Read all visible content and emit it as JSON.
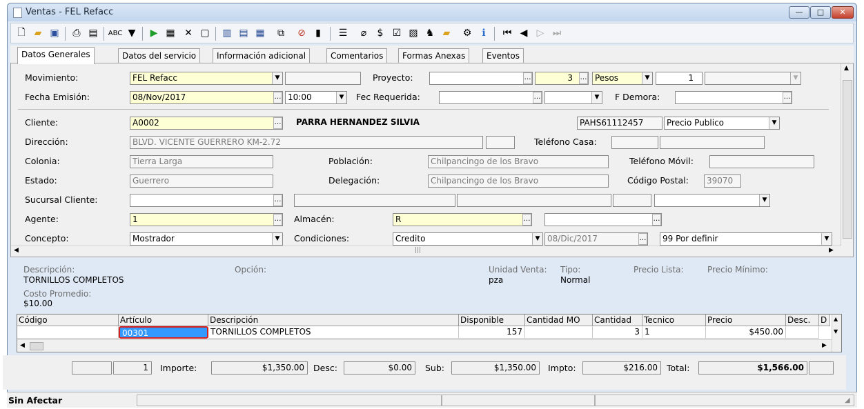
{
  "window": {
    "title": "Ventas - FEL Refacc"
  },
  "tabs": [
    "Datos Generales",
    "Datos del servicio",
    "Información adicional",
    "Comentarios",
    "Formas Anexas",
    "Eventos"
  ],
  "form": {
    "movimiento_label": "Movimiento:",
    "movimiento_value": "FEL Refacc",
    "proyecto_label": "Proyecto:",
    "proyecto_num": "3",
    "moneda": "Pesos",
    "tipo_cambio": "1",
    "fecha_emision_label": "Fecha Emisión:",
    "fecha_emision": "08/Nov/2017",
    "hora": "10:00",
    "fec_requerida_label": "Fec Requerida:",
    "f_demora_label": "F Demora:",
    "cliente_label": "Cliente:",
    "cliente_codigo": "A0002",
    "cliente_nombre": "PARRA HERNANDEZ SILVIA",
    "rfc": "PAHS61112457",
    "lista_precios": "Precio Publico",
    "direccion_label": "Dirección:",
    "direccion": "BLVD. VICENTE GUERRERO KM-2.72",
    "telefono_casa_label": "Teléfono Casa:",
    "colonia_label": "Colonia:",
    "colonia": "Tierra Larga",
    "poblacion_label": "Población:",
    "poblacion": "Chilpancingo de los Bravo",
    "telefono_movil_label": "Teléfono Móvil:",
    "estado_label": "Estado:",
    "estado": "Guerrero",
    "delegacion_label": "Delegación:",
    "delegacion": "Chilpancingo de los Bravo",
    "codigo_postal_label": "Código Postal:",
    "codigo_postal": "39070",
    "sucursal_label": "Sucursal Cliente:",
    "agente_label": "Agente:",
    "agente": "1",
    "almacen_label": "Almacén:",
    "almacen": "R",
    "concepto_label": "Concepto:",
    "concepto": "Mostrador",
    "condiciones_label": "Condiciones:",
    "condiciones": "Credito",
    "vencimiento": "08/Dic/2017",
    "forma_pago": "99 Por definir"
  },
  "info": {
    "descripcion_label": "Descripción:",
    "descripcion": "TORNILLOS COMPLETOS",
    "opcion_label": "Opción:",
    "unidad_label": "Unidad Venta:",
    "unidad": "pza",
    "tipo_label": "Tipo:",
    "tipo": "Normal",
    "precio_lista_label": "Precio Lista:",
    "precio_minimo_label": "Precio Mínimo:",
    "costo_label": "Costo Promedio:",
    "costo": "$10.00"
  },
  "grid": {
    "headers": [
      "Código",
      "Artículo",
      "Descripción",
      "Disponible",
      "Cantidad MO",
      "Cantidad",
      "Tecnico",
      "Precio",
      "Desc.",
      "D"
    ],
    "row": {
      "codigo": "",
      "articulo": "00301",
      "descripcion": "TORNILLOS COMPLETOS",
      "disponible": "157",
      "cantidad_mo": "",
      "cantidad": "3",
      "tecnico": "1",
      "precio": "$450.00",
      "desc": ""
    }
  },
  "totals": {
    "count": "1",
    "importe_label": "Importe:",
    "importe": "$1,350.00",
    "desc_label": "Desc:",
    "desc": "$0.00",
    "sub_label": "Sub:",
    "sub": "$1,350.00",
    "impto_label": "Impto:",
    "impto": "$216.00",
    "total_label": "Total:",
    "total": "$1,566.00"
  },
  "status": {
    "text": "Sin Afectar"
  },
  "colors": {
    "highlight_border": "#d62020",
    "selection": "#3399ff",
    "input_yellow": "#ffffd6"
  }
}
